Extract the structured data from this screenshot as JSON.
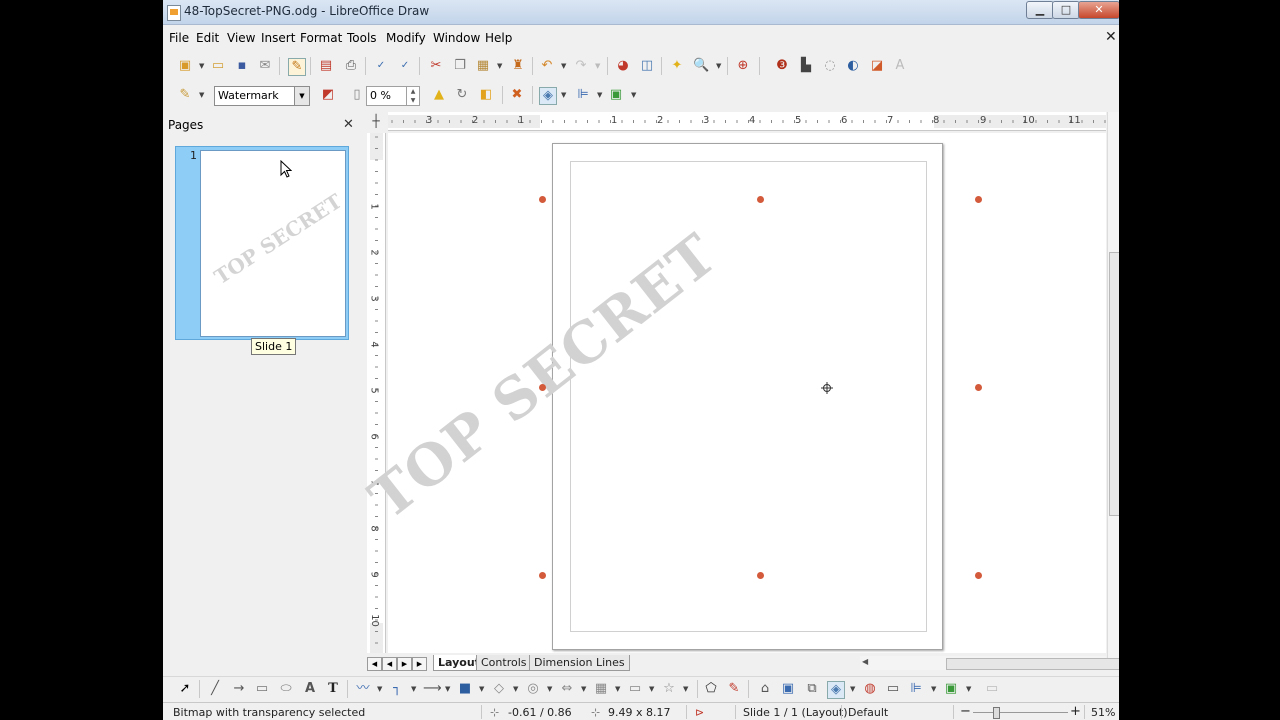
{
  "window": {
    "title": "48-TopSecret-PNG.odg - LibreOffice Draw",
    "min": "▁",
    "max": "□",
    "close": "✕",
    "doc_close": "✕"
  },
  "menu": [
    "File",
    "Edit",
    "View",
    "Insert",
    "Format",
    "Tools",
    "Modify",
    "Window",
    "Help"
  ],
  "toolbar2": {
    "fill_style": "Watermark",
    "transparency": "0 %"
  },
  "pages_panel": {
    "title": "Pages",
    "close": "✕",
    "slide_number": "1",
    "thumbnail_watermark": "TOP SECRET",
    "tooltip": "Slide 1"
  },
  "ruler": {
    "corner": "┼",
    "h_numbers": [
      "3",
      "2",
      "1",
      "1",
      "2",
      "3",
      "4",
      "5",
      "6",
      "7",
      "8",
      "9",
      "10",
      "11"
    ],
    "v_numbers": [
      "1",
      "2",
      "3",
      "4",
      "5",
      "6",
      "7",
      "8",
      "9",
      "10"
    ]
  },
  "canvas": {
    "watermark_text": "TOP SECRET"
  },
  "tabs": {
    "layout": "Layout",
    "controls": "Controls",
    "dimension": "Dimension Lines"
  },
  "status": {
    "selection": "Bitmap with transparency selected",
    "position": "-0.61 / 0.86",
    "size": "9.49 x 8.17",
    "slide": "Slide 1 / 1 (Layout)",
    "master": "Default",
    "zoom": "51%"
  },
  "colors": {
    "handle": "#d35a3b",
    "thumb_selection": "#8ecdf5",
    "watermark": "#d2d2d2"
  }
}
